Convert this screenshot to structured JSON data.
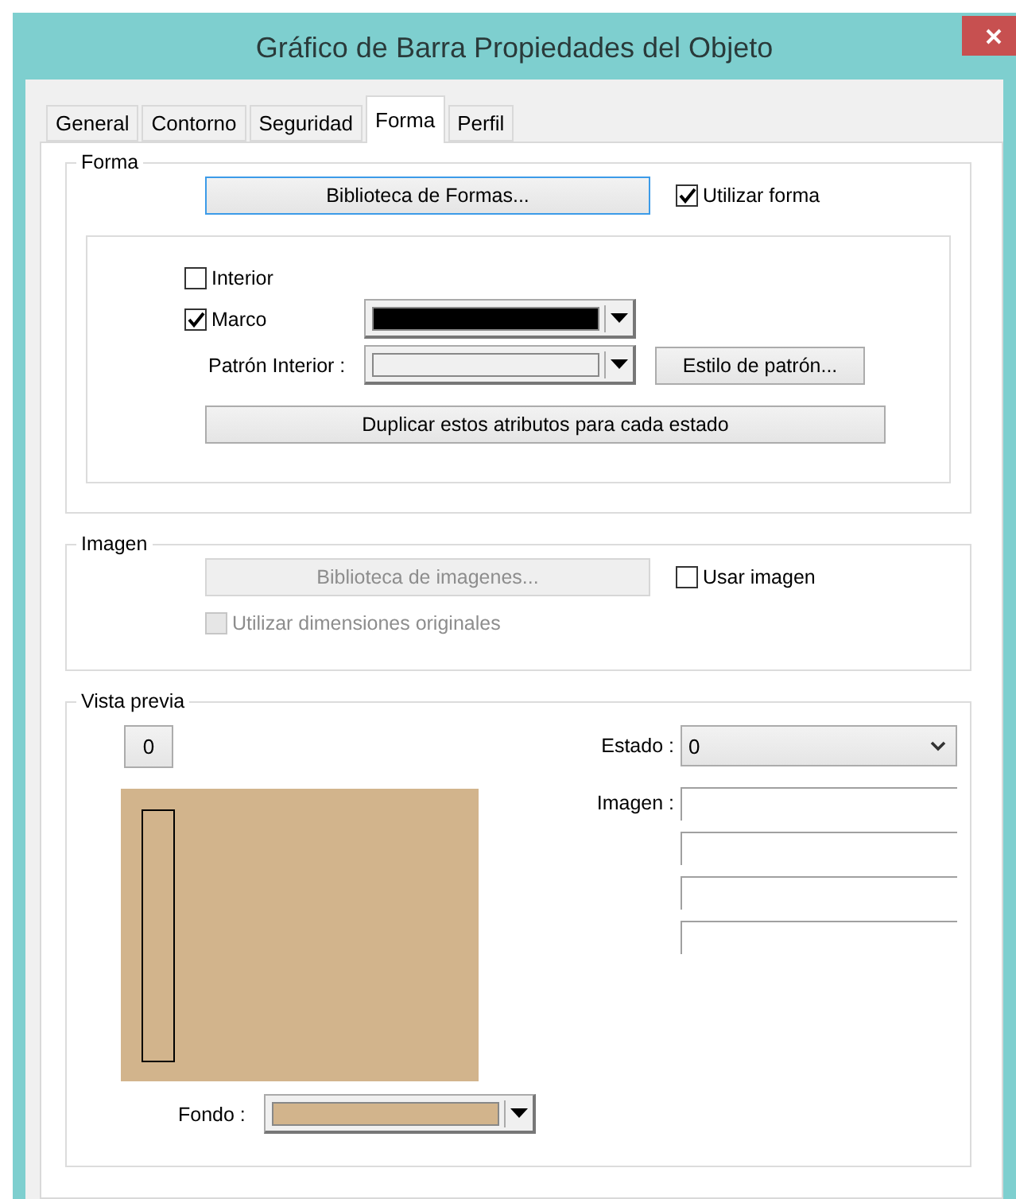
{
  "window": {
    "title": "Gráfico de Barra Propiedades del Objeto"
  },
  "tabs": [
    {
      "label": "General",
      "selected": false
    },
    {
      "label": "Contorno",
      "selected": false
    },
    {
      "label": "Seguridad",
      "selected": false
    },
    {
      "label": "Forma",
      "selected": true
    },
    {
      "label": "Perfil",
      "selected": false
    }
  ],
  "forma": {
    "legend": "Forma",
    "library_button": "Biblioteca de Formas...",
    "use_shape": {
      "label": "Utilizar forma",
      "checked": true
    },
    "interior": {
      "label": "Interior",
      "checked": false
    },
    "frame": {
      "label": "Marco",
      "checked": true,
      "color": "#000000"
    },
    "pattern": {
      "label": "Patrón Interior :",
      "color": "#f0f0f0"
    },
    "pattern_style_button": "Estilo de patrón...",
    "duplicate_button": "Duplicar estos atributos para cada estado"
  },
  "image": {
    "legend": "Imagen",
    "library_button": {
      "label": "Biblioteca de imagenes...",
      "disabled": true
    },
    "use_image": {
      "label": "Usar imagen",
      "checked": false,
      "disabled": false
    },
    "original_size": {
      "label": "Utilizar dimensiones originales",
      "checked": false,
      "disabled": true
    }
  },
  "preview": {
    "legend": "Vista previa",
    "state_button": "0",
    "state": {
      "label": "Estado :",
      "value": "0"
    },
    "image_label": "Imagen :",
    "background": {
      "label": "Fondo :",
      "color": "#d2b48c"
    }
  }
}
